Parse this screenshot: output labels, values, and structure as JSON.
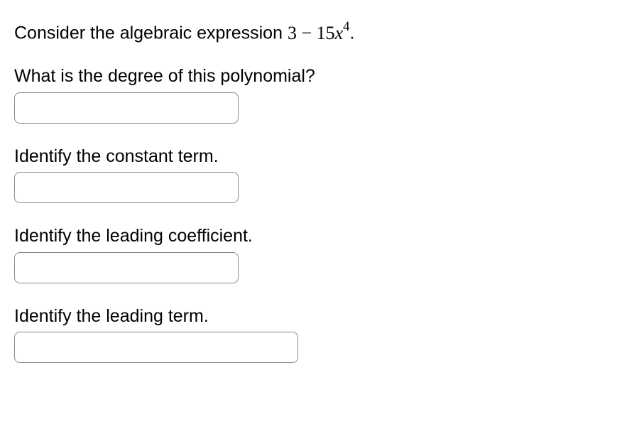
{
  "intro": {
    "prefix": "Consider the algebraic expression ",
    "expr_plain": "3 − 15x",
    "expr_exp": "4",
    "suffix": "."
  },
  "questions": [
    {
      "label": "What is the degree of this polynomial?",
      "value": ""
    },
    {
      "label": "Identify the constant term.",
      "value": ""
    },
    {
      "label": "Identify the leading coefficient.",
      "value": ""
    },
    {
      "label": "Identify the leading term.",
      "value": ""
    }
  ]
}
